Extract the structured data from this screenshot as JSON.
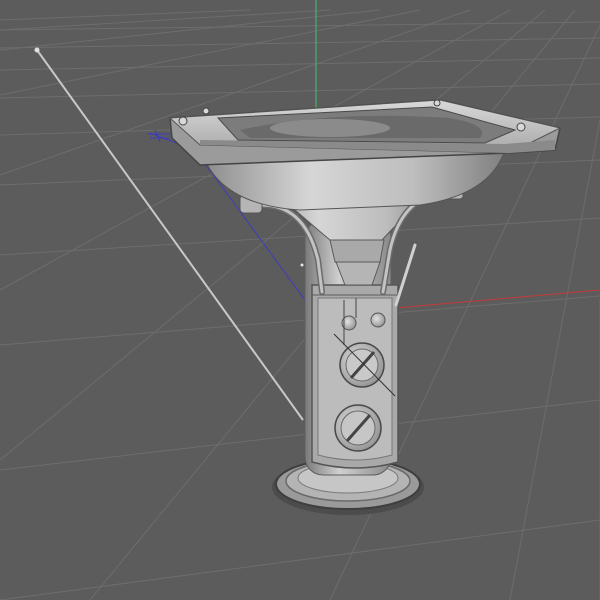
{
  "viewport": {
    "view": "perspective-3d",
    "background_color": "#5c5c5c",
    "grid_color": "#6e6e6e",
    "axes": {
      "x_color": "#c43a3a",
      "y_color": "#3fc46a",
      "z_color": "#3c3cc0"
    },
    "model": {
      "name": "pedestal-sink",
      "material_color": "#b9b9b9",
      "knobs": 2,
      "outlets": 2
    }
  }
}
